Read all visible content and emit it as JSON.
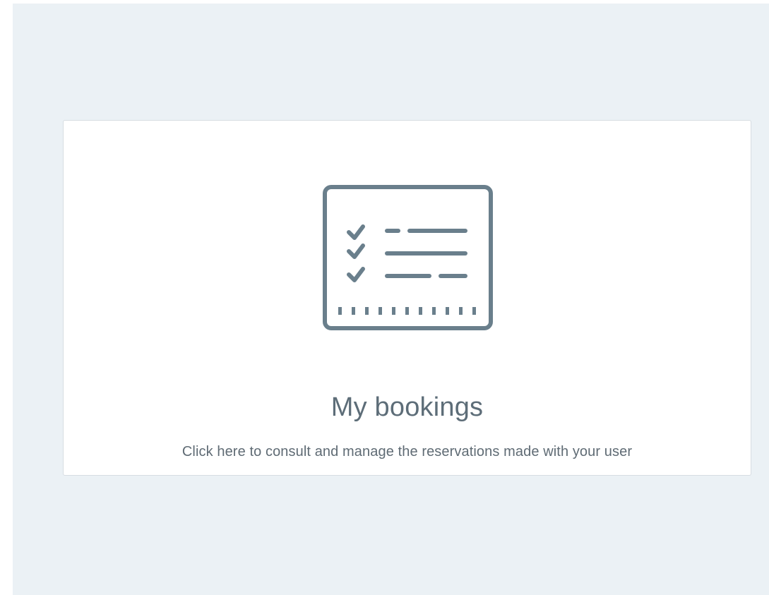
{
  "card": {
    "icon": "booking-checklist-icon",
    "title": "My bookings",
    "description": "Click here to consult and manage the reservations made with your user"
  },
  "colors": {
    "page_background": "#ebf1f5",
    "card_background": "#ffffff",
    "card_border": "#d7dde2",
    "icon": "#6a7f8c",
    "title_text": "#5d6d78",
    "description_text": "#5f6b74"
  }
}
